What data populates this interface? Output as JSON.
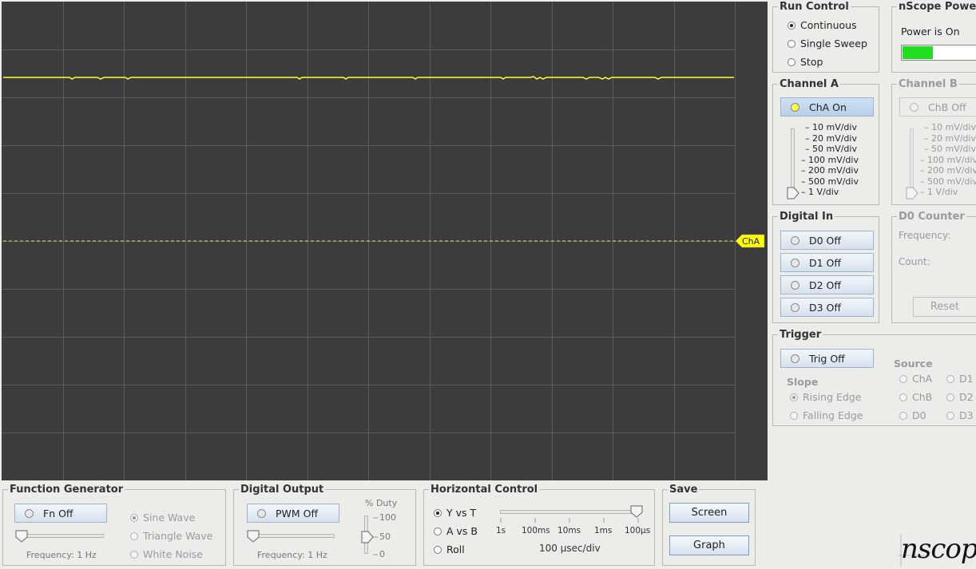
{
  "scope": {
    "channel_tag": "ChA",
    "colors": {
      "background": "#3c3c3c",
      "grid": "#5a5a5a",
      "trace": "#ffff33"
    }
  },
  "run_control": {
    "title": "Run Control",
    "options": [
      "Continuous",
      "Single Sweep",
      "Stop"
    ],
    "selected": "Continuous"
  },
  "power": {
    "title": "nScope Power",
    "status": "Power is On",
    "level": 0.35,
    "color": "#22dd22"
  },
  "channel_a": {
    "title": "Channel A",
    "button": "ChA On",
    "scales": [
      "10 mV/div",
      "20 mV/div",
      "50 mV/div",
      "100 mV/div",
      "200 mV/div",
      "500 mV/div",
      "1 V/div"
    ],
    "selected_scale": "1 V/div"
  },
  "channel_b": {
    "title": "Channel B",
    "button": "ChB Off",
    "scales": [
      "10 mV/div",
      "20 mV/div",
      "50 mV/div",
      "100 mV/div",
      "200 mV/div",
      "500 mV/div",
      "1 V/div"
    ],
    "selected_scale": "1 V/div"
  },
  "digital_in": {
    "title": "Digital In",
    "buttons": [
      "D0 Off",
      "D1 Off",
      "D2 Off",
      "D3 Off"
    ]
  },
  "d0_counter": {
    "title": "D0 Counter",
    "frequency_label": "Frequency:",
    "count_label": "Count:",
    "reset": "Reset"
  },
  "trigger": {
    "title": "Trigger",
    "button": "Trig Off",
    "slope_title": "Slope",
    "slope_options": [
      "Rising Edge",
      "Falling Edge"
    ],
    "slope_selected": "Rising Edge",
    "source_title": "Source",
    "sources": [
      "ChA",
      "D1",
      "ChB",
      "D2",
      "D0",
      "D3"
    ]
  },
  "function_generator": {
    "title": "Function Generator",
    "button": "Fn Off",
    "frequency": "Frequency: 1 Hz",
    "waves": [
      "Sine Wave",
      "Triangle Wave",
      "White Noise"
    ],
    "selected_wave": "Sine Wave"
  },
  "digital_output": {
    "title": "Digital Output",
    "button": "PWM Off",
    "frequency": "Frequency: 1 Hz",
    "duty_label": "% Duty",
    "duty_ticks": [
      "100",
      "50",
      "0"
    ],
    "duty_value": 50
  },
  "horizontal": {
    "title": "Horizontal Control",
    "modes": [
      "Y vs T",
      "A vs B",
      "Roll"
    ],
    "selected_mode": "Y vs T",
    "ticks": [
      "1s",
      "100ms",
      "10ms",
      "1ms",
      "100µs"
    ],
    "timebase": "100 µsec/div"
  },
  "save": {
    "title": "Save",
    "screen": "Screen",
    "graph": "Graph"
  },
  "logo": "nscope"
}
